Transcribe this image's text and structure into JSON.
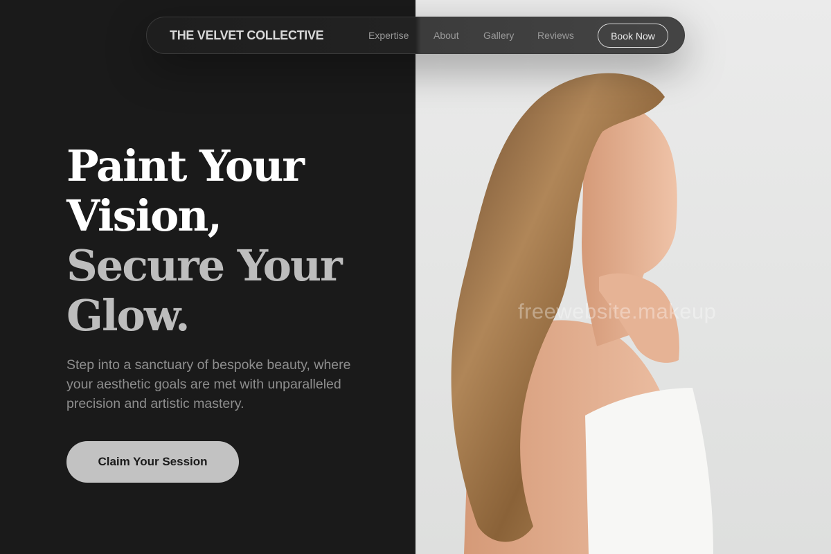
{
  "nav": {
    "brand": "THE VELVET COLLECTIVE",
    "links": [
      "Expertise",
      "About",
      "Gallery",
      "Reviews"
    ],
    "cta_label": "Book Now"
  },
  "hero": {
    "title_lines": [
      "Paint Your",
      "Vision,",
      "Secure Your",
      "Glow."
    ],
    "subtitle": "Step into a sanctuary of bespoke beauty, where your aesthetic goals are met with unparalleled precision and artistic mastery.",
    "cta_label": "Claim Your Session"
  },
  "image": {
    "description": "woman-profile-photo",
    "watermark": "freewebsite.makeup"
  },
  "colors": {
    "background": "#1a1a1a",
    "cta_bg": "#c2c2c2",
    "title_white": "#ffffff",
    "title_grey": "#bdbdbd",
    "subtitle": "#8e8e8e"
  }
}
